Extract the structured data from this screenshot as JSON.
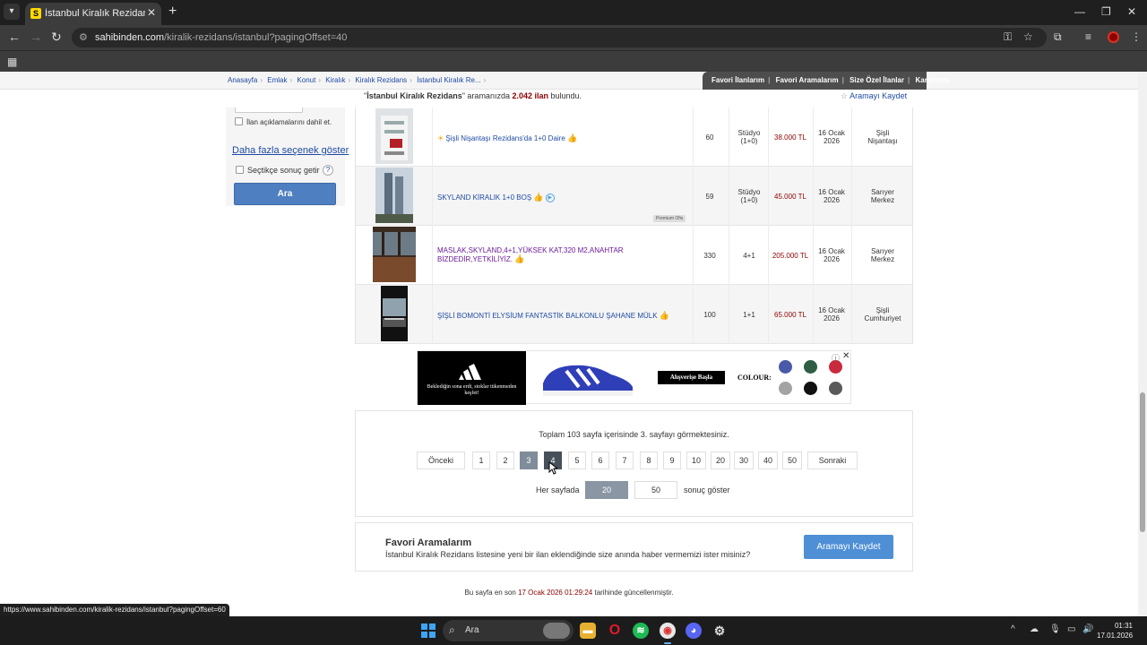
{
  "browser": {
    "tab_title": "İstanbul Kiralık Rezidans Fiyatları",
    "tab_favicon_letter": "S",
    "url_host": "sahibinden.com",
    "url_path": "/kiralik-rezidans/istanbul?pagingOffset=40",
    "status_url": "https://www.sahibinden.com/kiralik-rezidans/istanbul?pagingOffset=60"
  },
  "breadcrumb": [
    "Anasayfa",
    "Emlak",
    "Konut",
    "Kiralık",
    "Kiralık Rezidans",
    "İstanbul Kiralık Re..."
  ],
  "top_links": [
    "Favori İlanlarım",
    "Favori Aramalarım",
    "Size Özel İlanlar",
    "Karşılaştır"
  ],
  "results": {
    "query": "İstanbul Kiralık Rezidans",
    "pre": "\"",
    "mid": "\" aramanızda ",
    "count": "2.042 ilan",
    "post": " bulundu.",
    "save_search": "Aramayı Kaydet"
  },
  "filters": {
    "include_descriptions": "İlan açıklamalarını dahil et.",
    "more_options": "Daha fazla seçenek göster",
    "selective_results": "Seçtikçe sonuç getir",
    "help": "?",
    "search_button": "Ara"
  },
  "listings": [
    {
      "title": "Şişli Nişantaşı Rezidans'da 1+0 Daire",
      "m2": "60",
      "rooms1": "Stüdyo",
      "rooms2": "(1+0)",
      "price": "38.000 TL",
      "date1": "16 Ocak",
      "date2": "2026",
      "loc1": "Şişli",
      "loc2": "Nişantaşı",
      "visited": false
    },
    {
      "title": "SKYLAND KİRALIK 1+0 BOŞ",
      "m2": "59",
      "rooms1": "Stüdyo",
      "rooms2": "(1+0)",
      "price": "45.000 TL",
      "date1": "16 Ocak",
      "date2": "2026",
      "loc1": "Sarıyer",
      "loc2": "Merkez",
      "badge": "Premium Ofis",
      "visited": false
    },
    {
      "title": "MASLAK,SKYLAND,4+1,YÜKSEK KAT,320 M2,ANAHTAR",
      "title2": "BİZDEDİR,YETKİLİYİZ.",
      "m2": "330",
      "rooms1": "4+1",
      "rooms2": "",
      "price": "205.000 TL",
      "date1": "16 Ocak",
      "date2": "2026",
      "loc1": "Sarıyer",
      "loc2": "Merkez",
      "visited": true
    },
    {
      "title": "ŞİŞLİ BOMONTİ ELYSİUM FANTASTİK BALKONLU ŞAHANE MÜLK",
      "m2": "100",
      "rooms1": "1+1",
      "rooms2": "",
      "price": "65.000 TL",
      "date1": "16 Ocak",
      "date2": "2026",
      "loc1": "Şişli",
      "loc2": "Cumhuriyet",
      "visited": false
    }
  ],
  "ad": {
    "tagline": "Beklediğin sona erdi, stoklar tükenmeden keşfet!",
    "cta": "Alışverişe Başla",
    "colour_label": "COLOUR:",
    "swatches": [
      "#4a59a8",
      "#2e5e44",
      "#c92a3c",
      "#a3a3a3",
      "#111111",
      "#5a5a5a"
    ]
  },
  "pagination": {
    "summary": "Toplam 103 sayfa içerisinde 3. sayfayı görmektesiniz.",
    "prev": "Önceki",
    "pages": [
      "1",
      "2",
      "3",
      "4",
      "5",
      "6",
      "7",
      "8",
      "9",
      "10",
      "20",
      "30",
      "40",
      "50"
    ],
    "current": "3",
    "hover": "4",
    "next": "Sonraki",
    "per_page_label": "Her sayfada",
    "per_page_options": [
      "20",
      "50"
    ],
    "per_page_selected": "20",
    "per_page_after": "sonuç göster"
  },
  "saved_searches": {
    "title": "Favori Aramalarım",
    "desc": "İstanbul Kiralık Rezidans listesine yeni bir ilan eklendiğinde size anında haber vermemizi ister misiniz?",
    "button": "Aramayı Kaydet"
  },
  "updated": {
    "pre": "Bu sayfa en son ",
    "date": "17 Ocak 2026 01:29:24",
    "post": " tarihinde güncellenmiştir."
  },
  "taskbar": {
    "search_label": "Ara",
    "time": "01:31",
    "date": "17.01.2026"
  }
}
